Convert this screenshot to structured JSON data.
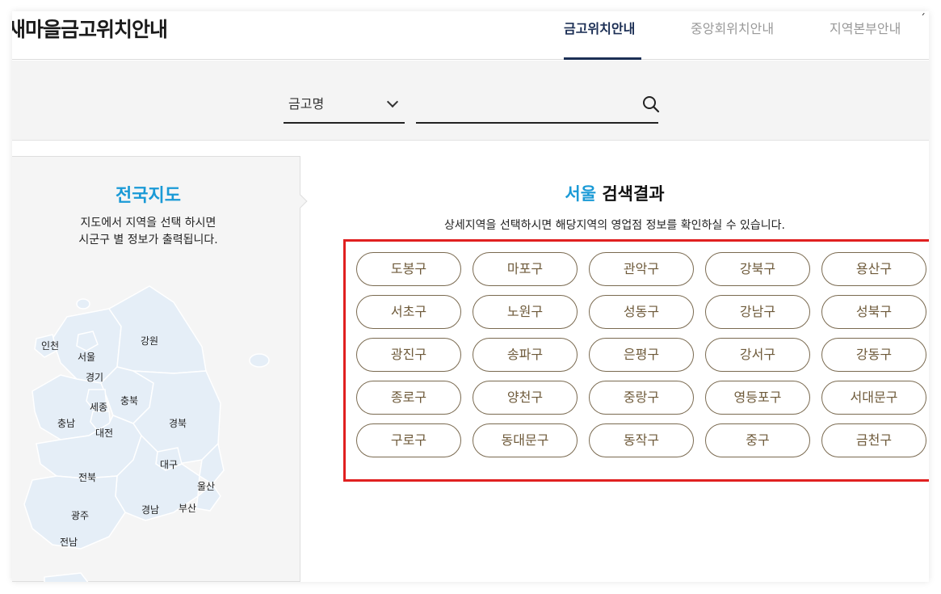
{
  "header": {
    "site_title": "새마을금고위치안내",
    "tabs": [
      {
        "label": "금고위치안내",
        "active": true
      },
      {
        "label": "중앙회위치안내",
        "active": false
      },
      {
        "label": "지역본부안내",
        "active": false
      }
    ]
  },
  "search": {
    "select_value": "금고명",
    "input_value": "",
    "input_placeholder": ""
  },
  "map": {
    "title": "전국지도",
    "desc_line1": "지도에서 지역을 선택 하시면",
    "desc_line2": "시군구 별 정보가 출력됩니다.",
    "regions": [
      "인천",
      "서울",
      "강원",
      "경기",
      "충북",
      "세종",
      "충남",
      "대전",
      "경북",
      "대구",
      "전북",
      "울산",
      "광주",
      "경남",
      "부산",
      "전남"
    ]
  },
  "results": {
    "city": "서울",
    "title_suffix": "검색결과",
    "desc": "상세지역을 선택하시면 해당지역의 영업점 정보를 확인하실 수 있습니다.",
    "districts": [
      "도봉구",
      "마포구",
      "관악구",
      "강북구",
      "용산구",
      "서초구",
      "노원구",
      "성동구",
      "강남구",
      "성북구",
      "광진구",
      "송파구",
      "은평구",
      "강서구",
      "강동구",
      "종로구",
      "양천구",
      "중랑구",
      "영등포구",
      "서대문구",
      "구로구",
      "동대문구",
      "동작구",
      "중구",
      "금천구"
    ]
  },
  "colors": {
    "accent_blue": "#1a9ad6",
    "nav_active": "#1c2f55",
    "district_text": "#6e5a3a",
    "highlight_red": "#e02020",
    "map_fill": "#e5eef7"
  }
}
